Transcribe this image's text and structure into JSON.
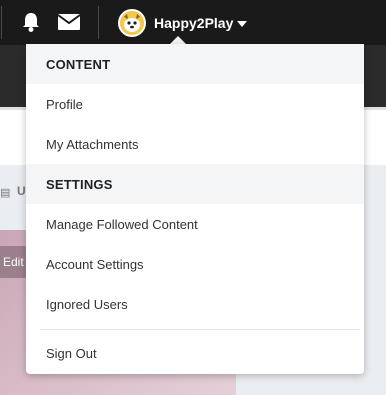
{
  "topbar": {
    "user": {
      "name": "Happy2Play"
    },
    "icons": {
      "notifications": "bell-icon",
      "messages": "envelope-icon",
      "caret": "caret-down-icon"
    }
  },
  "background": {
    "crumb_text": "U",
    "edit_label": "Edit"
  },
  "dropdown": {
    "sections": [
      {
        "header": "CONTENT",
        "items": [
          "Profile",
          "My Attachments"
        ]
      },
      {
        "header": "SETTINGS",
        "items": [
          "Manage Followed Content",
          "Account Settings",
          "Ignored Users"
        ]
      }
    ],
    "footer_item": "Sign Out"
  }
}
